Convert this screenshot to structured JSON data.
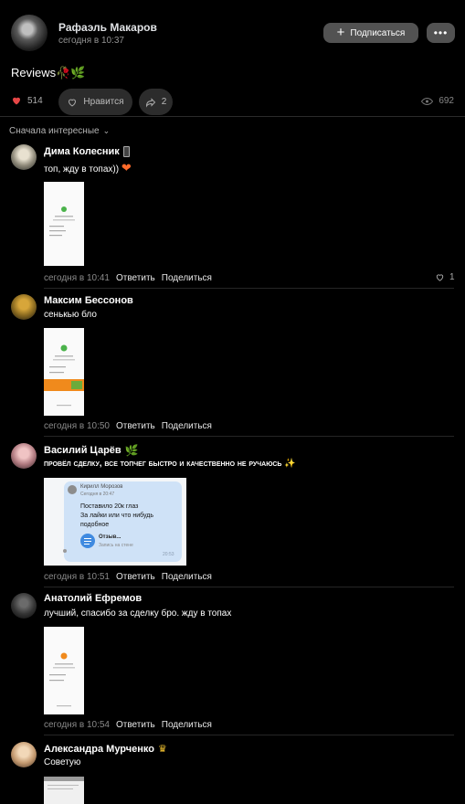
{
  "post": {
    "author": "Рафаэль Макаров",
    "time": "сегодня в 10:37",
    "subscribe_label": "Подписаться",
    "more_label": "•••",
    "text": "Reviews",
    "likes_count": "514",
    "like_button_label": "Нравится",
    "shares_count": "2",
    "views_count": "692"
  },
  "sort_label": "Сначала интересные",
  "comments": [
    {
      "name": "Дима Колесник",
      "text": "топ, жду в топах))",
      "time": "сегодня в 10:41",
      "reply": "Ответить",
      "share": "Поделиться",
      "likes": "1"
    },
    {
      "name": "Максим Бессонов",
      "text": "сенькью бло",
      "time": "сегодня в 10:50",
      "reply": "Ответить",
      "share": "Поделиться"
    },
    {
      "name": "Василий Царёв",
      "text": "провёл сделку, все топчег быстро и качественно не ручаюсь",
      "time": "сегодня в 10:51",
      "reply": "Ответить",
      "share": "Поделиться",
      "attachment": {
        "name": "Кирилл Морозов",
        "time": "Сегодня в 20:47",
        "text": "Поставило 20к глаз\nЗа лайки или что нибудь подобное",
        "link_title": "Отзыв...",
        "link_sub": "Запись на стене",
        "stamp": "20:53"
      }
    },
    {
      "name": "Анатолий Ефремов",
      "text": "лучший, спасибо за сделку бро. жду в топах",
      "time": "сегодня в 10:54",
      "reply": "Ответить",
      "share": "Поделиться"
    },
    {
      "name": "Александра Мурченко",
      "text": "Советую"
    }
  ]
}
